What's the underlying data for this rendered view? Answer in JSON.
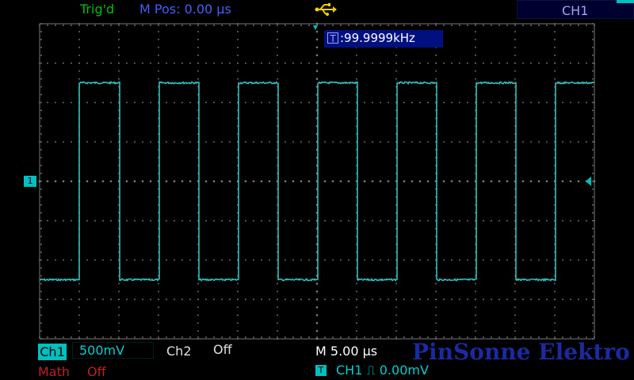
{
  "status": {
    "trig": "Trig'd",
    "mpos": "M Pos: 0.00 µs",
    "usb_icon": "usb-icon",
    "ch_label": "CH1"
  },
  "measurement": {
    "trigger_icon": "T",
    "freq": ":99.9999kHz"
  },
  "channel_marker": "1",
  "bottom": {
    "ch1": "Ch1",
    "ch1_scale": "500mV",
    "ch2": "Ch2",
    "ch2_state": "Off",
    "timebase": "M 5.00 µs",
    "math": "Math",
    "math_state": "Off",
    "trig_tag": "T",
    "trig_source": "CH1  ⎍  0.00mV"
  },
  "watermark": "PinSonne Elektro",
  "colors": {
    "trace": "#30c0c0",
    "grid": "#7a7a7a"
  },
  "waveform": {
    "type": "square",
    "frequency_khz": 99.9999,
    "high_div": 2.5,
    "low_div": -2.5,
    "time_per_div_us": 5.0,
    "volts_per_div_mv": 500
  }
}
